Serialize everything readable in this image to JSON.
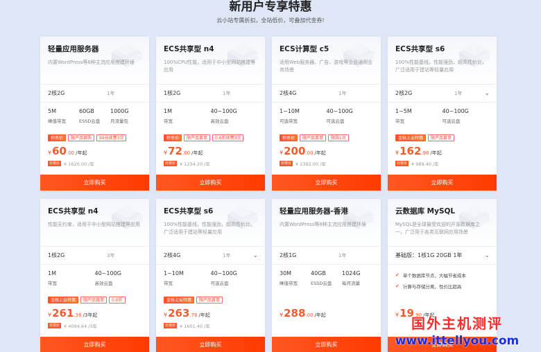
{
  "header": {
    "title": "新用户专享特惠",
    "subtitle": "云小站专属折扣，全站低价，可叠加代金券!"
  },
  "buy_label": "立即购买",
  "orig_tag": "日常价",
  "currency": "¥",
  "colors": {
    "accent": "#ff5722",
    "price": "#f55a2a",
    "page_bg": "#dfe6f6",
    "watermark_red": "#ff2a2a",
    "watermark_blue": "#1a2fd8"
  },
  "cards": [
    {
      "title": "轻量应用服务器",
      "desc": "内置WordPress等8种主流应用搭建环境",
      "spec": "2核2G",
      "period": "1年",
      "dropdown": false,
      "stats": [
        {
          "v": "5M",
          "l": "峰值带宽"
        },
        {
          "v": "60GB",
          "l": "ESSD云盘"
        },
        {
          "v": "1000G",
          "l": "月流量包"
        }
      ],
      "badges": [
        {
          "t": "秒杀价",
          "solid": true
        },
        {
          "t": "限产品首购",
          "solid": false
        },
        {
          "t": "99元续费3次",
          "solid": false
        }
      ],
      "price_int": "60",
      "price_dec": ".00",
      "unit": "/年起",
      "orig": "¥ 1620.00 /年"
    },
    {
      "title": "ECS共享型 n4",
      "desc": "100%CPU性能，适用于中小型网站搭建等应用",
      "spec": "1核2G",
      "period": "1年",
      "dropdown": false,
      "stats": [
        {
          "v": "1M",
          "l": "带宽"
        },
        {
          "v": "40~100G",
          "l": "高效云盘"
        }
      ],
      "badges": [
        {
          "t": "秒杀价",
          "solid": true
        },
        {
          "t": "限产品首单",
          "solid": false
        },
        {
          "t": "0.6折续费3次",
          "solid": false
        }
      ],
      "price_int": "72",
      "price_dec": ".60",
      "unit": "/年起",
      "orig": "¥ 1234.20 /年"
    },
    {
      "title": "ECS计算型 c5",
      "desc": "适用Web服务器、广告、游戏等企业通用业务场景",
      "spec": "2核4G",
      "period": "1年",
      "dropdown": false,
      "stats": [
        {
          "v": "1~10M",
          "l": "可选带宽"
        },
        {
          "v": "40~100G",
          "l": "可选云盘"
        }
      ],
      "badges": [
        {
          "t": "秒杀价",
          "solid": true
        },
        {
          "t": "限产品首单",
          "solid": false
        },
        {
          "t": "限购1台",
          "solid": false
        }
      ],
      "price_int": "200",
      "price_dec": ".00",
      "unit": "/年起",
      "orig": "¥ 2392.00 /年"
    },
    {
      "title": "ECS共享型 s6",
      "desc": "100%性能基线，性能强劲，超高性价比，广泛适用于建站等轻量应用",
      "spec": "2核2G",
      "period": "1年",
      "dropdown": true,
      "stats": [
        {
          "v": "1~5M",
          "l": "带宽"
        },
        {
          "v": "40~100G",
          "l": "可选云盘"
        }
      ],
      "badges": [
        {
          "t": "金秋上云特惠",
          "solid": true
        },
        {
          "t": "限产品首单",
          "solid": false
        }
      ],
      "price_int": "162",
      "price_dec": ".96",
      "unit": "/年起",
      "orig": "¥ 989.40 /年"
    },
    {
      "title": "ECS共享型 n4",
      "desc": "性能无约束，适用于中小型网站搭建等应用",
      "spec": "1核2G",
      "period": "3年",
      "dropdown": false,
      "stats": [
        {
          "v": "1M",
          "l": "带宽"
        },
        {
          "v": "40~100G",
          "l": "高效云盘"
        }
      ],
      "badges": [
        {
          "t": "金秋上云特惠",
          "solid": true
        },
        {
          "t": "限产品首单",
          "solid": false
        },
        {
          "t": "0.6折",
          "solid": false
        }
      ],
      "price_int": "261",
      "price_dec": ".36",
      "unit": "/3年起",
      "orig": "¥ 4094.64 /3年"
    },
    {
      "title": "ECS共享型 s6",
      "desc": "100%性能基线，性能强劲，超高性价比，广泛适用于建站等轻量应用",
      "spec": "2核4G",
      "period": "1年",
      "dropdown": true,
      "stats": [
        {
          "v": "1~10M",
          "l": "带宽"
        },
        {
          "v": "40~100G",
          "l": "可选云盘"
        }
      ],
      "badges": [
        {
          "t": "金秋上云特惠",
          "solid": true
        },
        {
          "t": "限产品首单",
          "solid": false
        }
      ],
      "price_int": "263",
      "price_dec": ".76",
      "unit": "/年起",
      "orig": "¥ 1601.40 /年"
    },
    {
      "title": "轻量应用服务器-香港",
      "desc": "内置WordPress等8种主流应用搭建环境",
      "spec": "2核1G",
      "period": "1年",
      "dropdown": false,
      "stats": [
        {
          "v": "30M",
          "l": "峰值带宽"
        },
        {
          "v": "40GB",
          "l": "ESSD云盘"
        },
        {
          "v": "1024G",
          "l": "每月流量"
        }
      ],
      "badges": [],
      "price_int": "288",
      "price_dec": ".00",
      "unit": "/年起",
      "orig": ""
    },
    {
      "title": "云数据库 MySQL",
      "desc": "MySQL是全球最受欢迎的开源数据库之一，广泛用于各类互联网应用场景",
      "spec": "基础版：1核1G 20GB 1年",
      "period": "",
      "dropdown": true,
      "features": [
        "单个数据库节点，大幅节省成本",
        "计算与存储分离，性价比超高"
      ],
      "badges": [],
      "price_int": "19",
      "price_dec": ".90",
      "unit": "/年起",
      "orig": ""
    }
  ],
  "watermark": {
    "cn": "国外主机测评",
    "url": "www.ittellyou.com"
  }
}
